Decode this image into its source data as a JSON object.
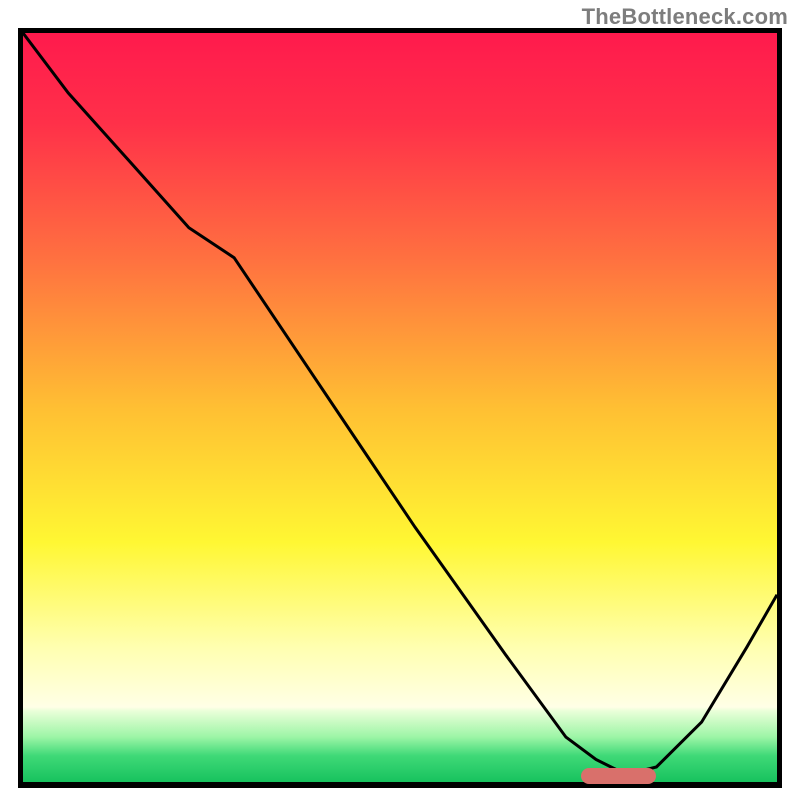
{
  "watermark": "TheBottleneck.com",
  "chart_data": {
    "type": "line",
    "title": "",
    "xlabel": "",
    "ylabel": "",
    "xlim": [
      0,
      100
    ],
    "ylim": [
      0,
      100
    ],
    "gradient_stops": [
      {
        "offset": 0.0,
        "color": "#ff1a4d"
      },
      {
        "offset": 0.12,
        "color": "#ff3049"
      },
      {
        "offset": 0.3,
        "color": "#ff7040"
      },
      {
        "offset": 0.5,
        "color": "#ffbf33"
      },
      {
        "offset": 0.68,
        "color": "#fff733"
      },
      {
        "offset": 0.82,
        "color": "#ffffb0"
      },
      {
        "offset": 0.9,
        "color": "#ffffe6"
      },
      {
        "offset": 0.905,
        "color": "#eaffd9"
      },
      {
        "offset": 0.94,
        "color": "#9cf5a6"
      },
      {
        "offset": 0.965,
        "color": "#3fd977"
      },
      {
        "offset": 1.0,
        "color": "#17c25e"
      }
    ],
    "series": [
      {
        "name": "curve",
        "x": [
          0,
          6,
          14,
          22,
          28,
          40,
          52,
          64,
          72,
          76,
          80,
          84,
          90,
          96,
          100
        ],
        "values": [
          100,
          92,
          83,
          74,
          70,
          52,
          34,
          17,
          6,
          3,
          1,
          2,
          8,
          18,
          25
        ]
      }
    ],
    "marker": {
      "x_start": 74,
      "x_end": 84,
      "y": 0.8
    }
  }
}
